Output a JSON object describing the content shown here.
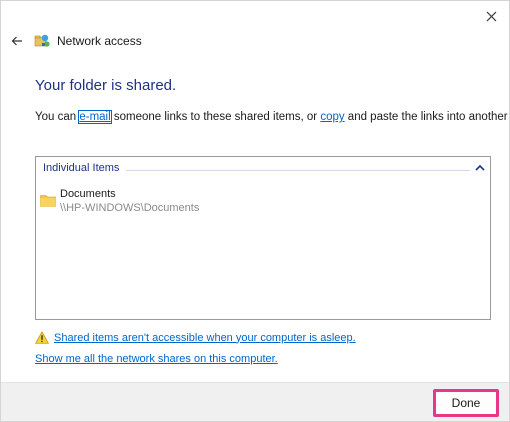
{
  "window": {
    "title": "Network access"
  },
  "main": {
    "heading": "Your folder is shared.",
    "description": {
      "prefix": "You can ",
      "email_link": "e-mail",
      "middle": " someone links to these shared items, or ",
      "copy_link": "copy",
      "suffix": " and paste the links into another app."
    }
  },
  "shared_items": {
    "group_label": "Individual Items",
    "items": [
      {
        "name": "Documents",
        "path": "\\\\HP-WINDOWS\\Documents",
        "icon": "folder-icon"
      }
    ]
  },
  "links": {
    "asleep_warning": "Shared items aren't accessible when your computer is asleep.",
    "show_shares": "Show me all the network shares on this computer."
  },
  "footer": {
    "done_label": "Done"
  },
  "colors": {
    "heading": "#1e3287",
    "link": "#0066cc",
    "done_highlight": "#e8378a"
  },
  "icons": [
    "close-icon",
    "back-arrow-icon",
    "network-share-icon",
    "chevron-up-icon",
    "folder-icon",
    "warning-icon"
  ]
}
